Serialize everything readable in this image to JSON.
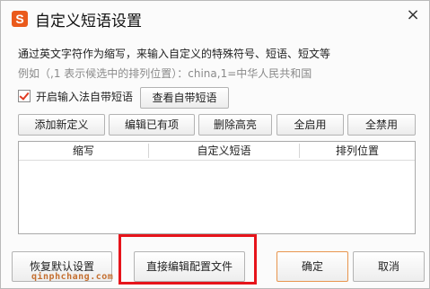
{
  "dialog": {
    "logo_char": "S",
    "title": "自定义短语设置",
    "close_glyph": "×",
    "description": "通过英文字符作为缩写，来输入自定义的特殊符号、短语、短文等",
    "example": "例如（,1 表示候选中的排列位置）：china,1=中华人民共和国"
  },
  "options": {
    "enable_label": "开启输入法自带短语",
    "enable_checked": true,
    "view_builtin_label": "查看自带短语"
  },
  "toolbar": {
    "add_label": "添加新定义",
    "edit_label": "编辑已有项",
    "delete_label": "删除高亮",
    "enable_all_label": "全启用",
    "disable_all_label": "全禁用"
  },
  "table": {
    "columns": [
      "缩写",
      "自定义短语",
      "排列位置"
    ],
    "rows": []
  },
  "footer": {
    "restore_label": "恢复默认设置",
    "edit_config_label": "直接编辑配置文件",
    "ok_label": "确定",
    "cancel_label": "取消"
  },
  "watermark": "qinphchang.com",
  "colors": {
    "logo_bg": "#ea5a1c",
    "checkmark": "#e03a22",
    "highlight_box": "#e6141b",
    "ok_border": "#e8954e"
  }
}
